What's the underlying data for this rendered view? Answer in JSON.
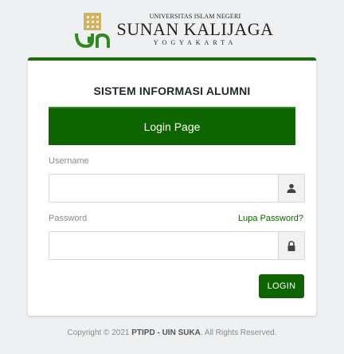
{
  "logo": {
    "top_text": "UNIVERSITAS ISLAM NEGERI",
    "name": "SUNAN KALIJAGA",
    "city": "YOGYAKARTA"
  },
  "card": {
    "title": "SISTEM INFORMASI ALUMNI",
    "banner": "Login Page"
  },
  "form": {
    "username_label": "Username",
    "username_value": "",
    "password_label": "Password",
    "password_value": "",
    "forgot_link": "Lupa Password?",
    "login_button": "LOGIN"
  },
  "footer": {
    "prefix": "Copyright © 2021 ",
    "bold": "PTIPD - UIN SUKA",
    "suffix": ". All Rights Reserved."
  },
  "colors": {
    "brand_green": "#0e6500",
    "background": "#eef0f2"
  },
  "icons": [
    "logo-emblem-icon",
    "user-icon",
    "lock-icon"
  ]
}
